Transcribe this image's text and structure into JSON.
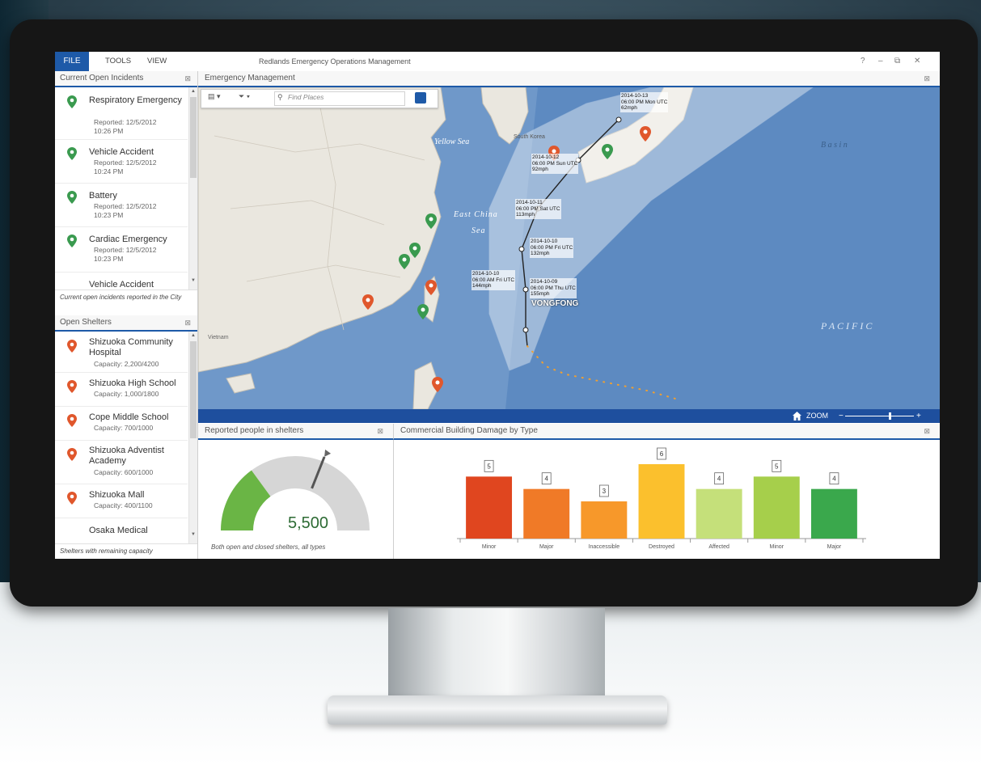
{
  "window": {
    "menu_file": "FILE",
    "menu_tools": "TOOLS",
    "menu_view": "VIEW",
    "title": "Redlands Emergency Operations Management",
    "help": "?",
    "minimize": "–",
    "restore": "⧉",
    "close": "✕"
  },
  "incidents": {
    "header": "Current Open Incidents",
    "close": "⊠",
    "items": [
      {
        "name": "Respiratory Emergency",
        "reported": "Reported: 12/5/2012",
        "time": "10:26 PM"
      },
      {
        "name": "Vehicle Accident",
        "reported": "Reported: 12/5/2012",
        "time": "10:24 PM"
      },
      {
        "name": "Battery",
        "reported": "Reported: 12/5/2012",
        "time": "10:23 PM"
      },
      {
        "name": "Cardiac Emergency",
        "reported": "Reported: 12/5/2012",
        "time": "10:23 PM"
      },
      {
        "name": "Vehicle Accident"
      }
    ],
    "footer": "Current open incidents reported in the City"
  },
  "shelters": {
    "header": "Open Shelters",
    "close": "⊠",
    "items": [
      {
        "name": "Shizuoka Community Hospital",
        "capacity": "Capacity: 2,200/4200"
      },
      {
        "name": "Shizuoka High School",
        "capacity": "Capacity: 1,000/1800"
      },
      {
        "name": "Cope Middle School",
        "capacity": "Capacity: 700/1000"
      },
      {
        "name": "Shizuoka Adventist Academy",
        "capacity": "Capacity: 600/1000"
      },
      {
        "name": "Shizuoka Mall",
        "capacity": "Capacity: 400/1100"
      },
      {
        "name": "Osaka Medical"
      }
    ],
    "footer": "Shelters with remaining capacity"
  },
  "map": {
    "header": "Emergency Management",
    "close": "⊠",
    "search_placeholder": "Find Places",
    "zoom_label": "ZOOM",
    "labels": {
      "yellow_sea": "Yellow Sea",
      "east_china": "East China",
      "sea": "Sea",
      "pacific": "P A C I F I C",
      "basin": "B a s i n",
      "vongfong": "VONGFONG",
      "south_korea": "South Korea",
      "vietnam": "Vietnam"
    },
    "track_labels": [
      {
        "date": "2014-10-13",
        "time": "06:00 PM Mon UTC",
        "speed": "62mph"
      },
      {
        "date": "2014-10-12",
        "time": "06:00 PM Sun UTC",
        "speed": "92mph"
      },
      {
        "date": "2014-10-11",
        "time": "06:00 PM Sat UTC",
        "speed": "113mph"
      },
      {
        "date": "2014-10-10",
        "time": "06:00 PM Fri UTC",
        "speed": "132mph"
      },
      {
        "date": "2014-10-10",
        "time": "06:00 AM Fri UTC",
        "speed": "144mph"
      },
      {
        "date": "2014-10-09",
        "time": "06:00 PM Thu UTC",
        "speed": "155mph"
      }
    ],
    "pins": [
      {
        "color": "#e0572c"
      },
      {
        "color": "#3a9a4f"
      },
      {
        "color": "#e0572c"
      }
    ]
  },
  "gauge": {
    "header": "Reported people in shelters",
    "close": "⊠",
    "value": "5,500",
    "fraction": 0.3,
    "footer": "Both open and closed shelters, all types",
    "fill_color": "#6ab545",
    "track_color": "#d6d6d6"
  },
  "chart_data": {
    "type": "bar",
    "title": "Commercial Building Damage by Type",
    "categories": [
      "Minor",
      "Major",
      "Inaccessible",
      "Destroyed",
      "Affected",
      "Minor",
      "Major"
    ],
    "values": [
      5,
      4,
      3,
      6,
      4,
      5,
      4
    ],
    "colors": [
      "#e0461f",
      "#f07a27",
      "#f7982a",
      "#fbc02d",
      "#c5e07a",
      "#a6cf4b",
      "#3aa84c"
    ],
    "ylim": [
      0,
      6
    ],
    "close": "⊠"
  }
}
